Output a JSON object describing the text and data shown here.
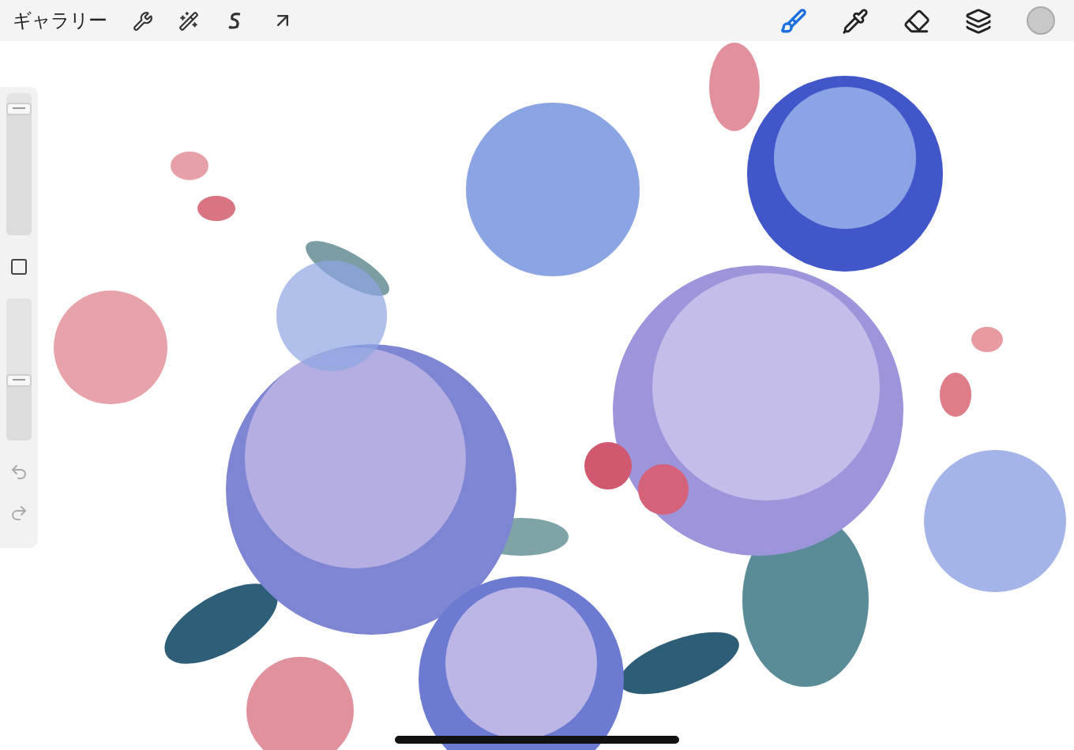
{
  "top_bar": {
    "gallery_label": "ギャラリー",
    "right_tools": [
      {
        "selected": true
      },
      {
        "selected": false
      },
      {
        "selected": false
      },
      {
        "selected": false
      }
    ],
    "color_swatch": {
      "color": "#c8c8c8"
    }
  },
  "sidebar": {
    "sliders": [
      {
        "level": 0.93
      },
      {
        "level": 0.42
      }
    ]
  }
}
